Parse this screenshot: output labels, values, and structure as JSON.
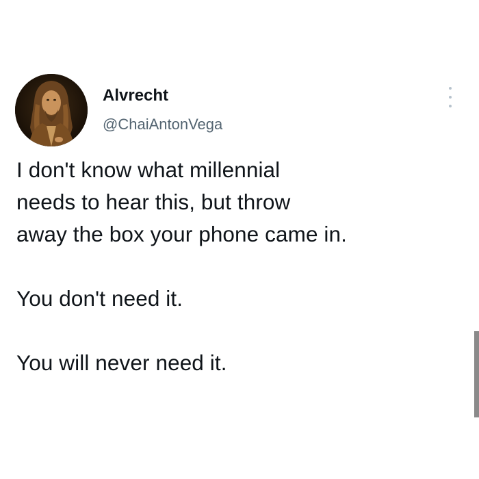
{
  "tweet": {
    "display_name": "Alvrecht",
    "handle": "@ChaiAntonVega",
    "avatar": "portrait-avatar",
    "more_icon": "more-vertical-icon",
    "body": {
      "line1": "I don't know what millennial",
      "line2": "needs to hear this, but throw",
      "line3": "away the box your phone came in.",
      "para2": "You don't need it.",
      "para3": "You will never need it."
    }
  },
  "colors": {
    "text": "#0f1419",
    "handle": "#536471",
    "more_icon": "#b6c2cc",
    "background": "#ffffff"
  }
}
